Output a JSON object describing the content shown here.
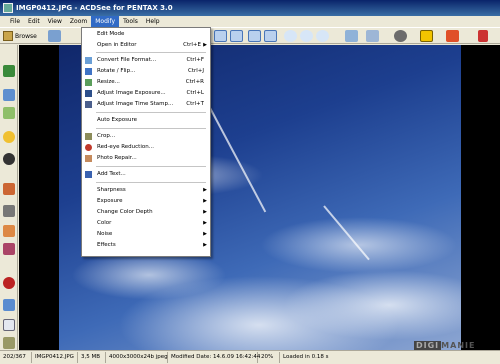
{
  "window": {
    "title": "IMGP0412.JPG - ACDSee for PENTAX 3.0"
  },
  "menubar": {
    "items": [
      "File",
      "Edit",
      "View",
      "Zoom",
      "Modify",
      "Tools",
      "Help"
    ],
    "active": "Modify"
  },
  "toolbar": {
    "browse_label": "Browse"
  },
  "modify_menu": {
    "items": [
      {
        "label": "Edit Mode",
        "shortcut": "",
        "icon": ""
      },
      {
        "label": "Open in Editor",
        "shortcut": "Ctrl+E",
        "submenu": true,
        "icon": ""
      },
      {
        "label": "Convert File Format...",
        "shortcut": "Ctrl+F",
        "icon": "convert-icon"
      },
      {
        "label": "Rotate / Flip...",
        "shortcut": "Ctrl+J",
        "icon": "rotate-icon"
      },
      {
        "label": "Resize...",
        "shortcut": "Ctrl+R",
        "icon": "resize-icon"
      },
      {
        "label": "Adjust Image Exposure...",
        "shortcut": "Ctrl+L",
        "icon": "exposure-icon"
      },
      {
        "label": "Adjust Image Time Stamp...",
        "shortcut": "Ctrl+T",
        "icon": "timestamp-icon"
      },
      {
        "label": "Auto Exposure",
        "shortcut": "",
        "icon": ""
      },
      {
        "label": "Crop...",
        "shortcut": "",
        "icon": "crop-icon"
      },
      {
        "label": "Red-eye Reduction...",
        "shortcut": "",
        "icon": "red-eye-icon"
      },
      {
        "label": "Photo Repair...",
        "shortcut": "",
        "icon": "photo-repair-icon"
      },
      {
        "label": "Add Text...",
        "shortcut": "",
        "icon": "add-text-icon"
      },
      {
        "label": "Sharpness",
        "shortcut": "",
        "submenu": true,
        "icon": ""
      },
      {
        "label": "Exposure",
        "shortcut": "",
        "submenu": true,
        "icon": ""
      },
      {
        "label": "Change Color Depth",
        "shortcut": "",
        "submenu": true,
        "icon": ""
      },
      {
        "label": "Color",
        "shortcut": "",
        "submenu": true,
        "icon": ""
      },
      {
        "label": "Noise",
        "shortcut": "",
        "submenu": true,
        "icon": ""
      },
      {
        "label": "Effects",
        "shortcut": "",
        "submenu": true,
        "icon": ""
      }
    ]
  },
  "statusbar": {
    "position": "202/367",
    "filename": "IMGP0412.JPG",
    "filesize": "3,5 MB",
    "dimensions": "4000x3000x24b jpeg",
    "modified": "Modified Date: 14.6.09 16:42:44",
    "zoom": "20%",
    "load_time": "Loaded in 0.18 s"
  },
  "watermark": {
    "part1": "DIGI",
    "part2": "MANIE"
  },
  "colors": {
    "menu_highlight": "#316ac5",
    "title_bar": "#0a246a",
    "chrome": "#ece9d8"
  }
}
